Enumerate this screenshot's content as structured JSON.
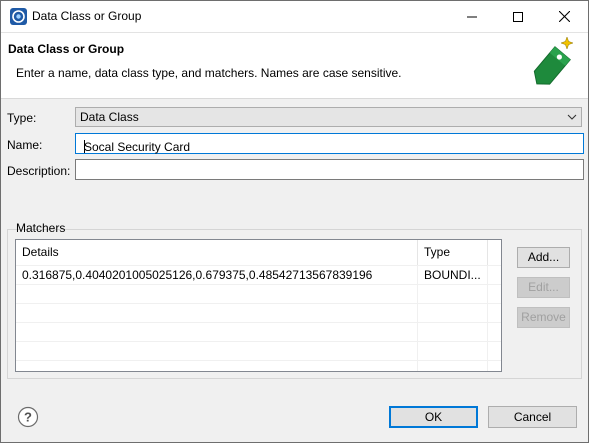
{
  "window": {
    "title": "Data Class or Group"
  },
  "banner": {
    "title": "Data Class or Group",
    "message": "Enter a name, data class type, and matchers. Names are case sensitive.",
    "image_icon": "green-tag-icon"
  },
  "form": {
    "type_label": "Type:",
    "type_value": "Data Class",
    "name_label": "Name:",
    "name_value": "Socal Security Card",
    "description_label": "Description:",
    "description_value": ""
  },
  "matchers": {
    "group_label": "Matchers",
    "columns": [
      "Details",
      "Type"
    ],
    "rows": [
      {
        "details": "0.316875,0.4040201005025126,0.679375,0.48542713567839196",
        "type": "BOUNDI..."
      }
    ],
    "buttons": {
      "add": "Add...",
      "edit": "Edit...",
      "remove": "Remove"
    }
  },
  "footer": {
    "ok": "OK",
    "cancel": "Cancel",
    "help_icon": "help-icon"
  },
  "colors": {
    "accent": "#0078d7",
    "tag_green": "#1e8a3c"
  }
}
